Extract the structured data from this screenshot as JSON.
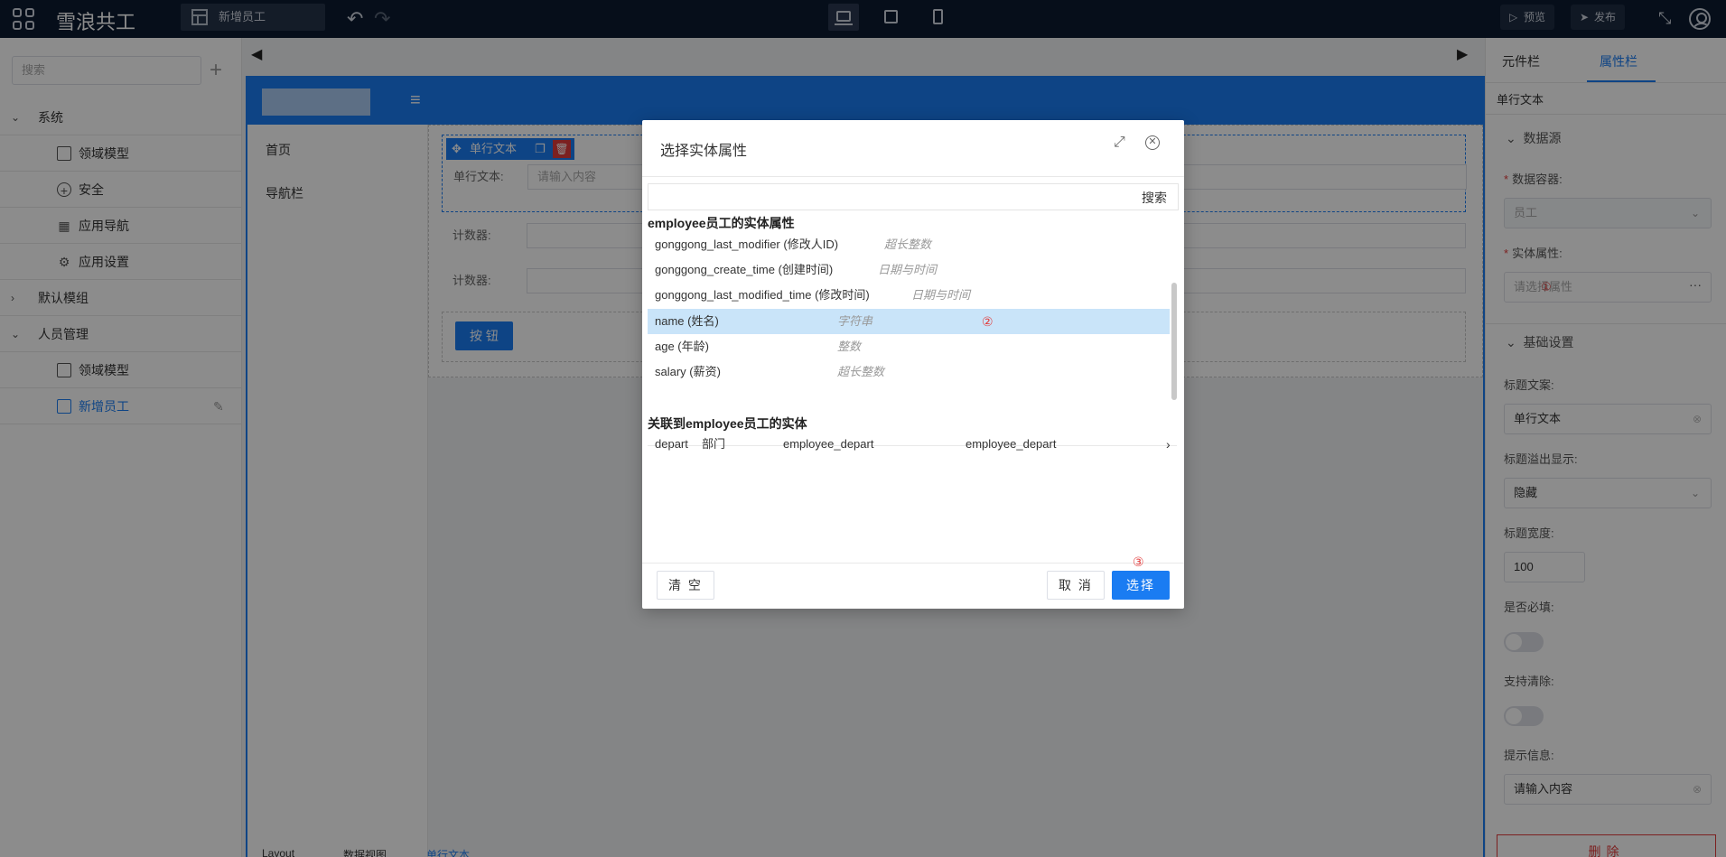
{
  "topbar": {
    "app_title": "雪浪共工",
    "page_tab": "新增员工",
    "undo": "↶",
    "redo": "↷",
    "preview_label": "预览",
    "publish_label": "发布"
  },
  "sidebar": {
    "search_placeholder": "搜索",
    "add": "+",
    "groups": [
      {
        "label": "系统",
        "arrow": "⌄",
        "children": [
          {
            "label": "领域模型"
          },
          {
            "label": "安全"
          },
          {
            "label": "应用导航"
          },
          {
            "label": "应用设置"
          }
        ]
      },
      {
        "label": "默认模组",
        "arrow": "›",
        "children": []
      },
      {
        "label": "人员管理",
        "arrow": "⌄",
        "children": [
          {
            "label": "领域模型"
          },
          {
            "label": "新增员工"
          }
        ]
      }
    ]
  },
  "canvas": {
    "nav_left": "◀",
    "nav_right": "▶",
    "menu_glyph": "≡",
    "side_nav": [
      "首页",
      "导航栏"
    ],
    "selected_field_tag": "单行文本",
    "field_label": "单行文本:",
    "field_placeholder": "请输入内容",
    "counter_label_1": "计数器:",
    "counter_label_2": "计数器:",
    "button_label": "按 钮"
  },
  "breadcrumbs": [
    "Layout",
    "数据视图",
    "单行文本"
  ],
  "right_panel": {
    "tabs": [
      "元件栏",
      "属性栏"
    ],
    "component_title": "单行文本",
    "section_data_source": "数据源",
    "data_container_label": "数据容器:",
    "data_container_value": "员工",
    "entity_attr_label": "实体属性:",
    "entity_attr_placeholder": "请选择属性",
    "entity_attr_mark": "①",
    "section_basic": "基础设置",
    "title_text_label": "标题文案:",
    "title_text_value": "单行文本",
    "title_overflow_label": "标题溢出显示:",
    "title_overflow_value": "隐藏",
    "title_width_label": "标题宽度:",
    "title_width_value": "100",
    "required_label": "是否必填:",
    "clearable_label": "支持清除:",
    "hint_label": "提示信息:",
    "hint_value": "请输入内容",
    "delete_label": "删除"
  },
  "modal": {
    "title": "选择实体属性",
    "search_label": "搜索",
    "entity_section": "employee员工的实体属性",
    "attributes": [
      {
        "name": "gonggong_last_modifier (修改人ID)",
        "type": "超长整数"
      },
      {
        "name": "gonggong_create_time (创建时间)",
        "type": "日期与时间"
      },
      {
        "name": "gonggong_last_modified_time (修改时间)",
        "type": "日期与时间"
      },
      {
        "name": "name (姓名)",
        "type": "字符串"
      },
      {
        "name": "age (年龄)",
        "type": "整数"
      },
      {
        "name": "salary (薪资)",
        "type": "超长整数"
      }
    ],
    "selected_mark": "②",
    "relation_section": "关联到employee员工的实体",
    "relation": {
      "name": "depart",
      "label": "部门",
      "col2": "employee_depart",
      "col3": "employee_depart"
    },
    "step_mark": "③",
    "clear_label": "清 空",
    "cancel_label": "取 消",
    "select_label": "选择"
  }
}
